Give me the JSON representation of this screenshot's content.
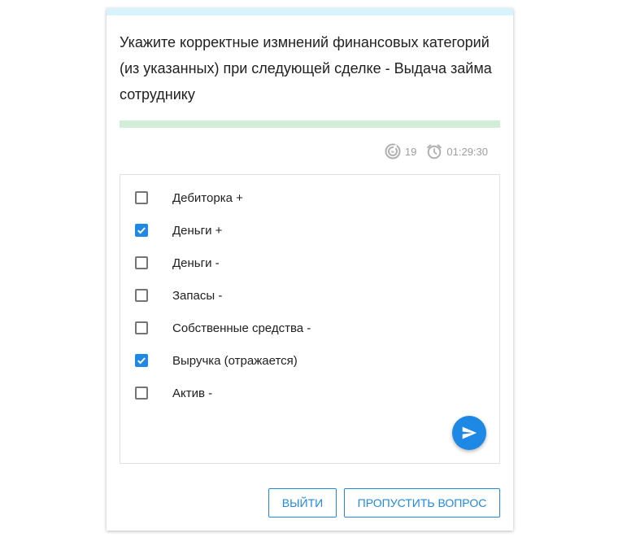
{
  "question": {
    "text": "Укажите корректные измнений финансовых категорий (из указанных) при следующей сделке - Выдача займа сотруднику"
  },
  "progress": {
    "fraction": 1.0
  },
  "stats": {
    "score_icon": "target-icon",
    "score_value": "19",
    "timer_icon": "alarm-clock-icon",
    "timer_value": "01:29:30"
  },
  "options": [
    {
      "label": "Дебиторка +",
      "checked": false
    },
    {
      "label": "Деньги +",
      "checked": true
    },
    {
      "label": "Деньги -",
      "checked": false
    },
    {
      "label": "Запасы -",
      "checked": false
    },
    {
      "label": "Собственные средства -",
      "checked": false
    },
    {
      "label": "Выручка (отражается)",
      "checked": true
    },
    {
      "label": "Актив -",
      "checked": false
    }
  ],
  "send_button": {
    "icon": "send-icon"
  },
  "buttons": {
    "exit_label": "ВЫЙТИ",
    "skip_label": "ПРОПУСТИТЬ ВОПРОС"
  },
  "colors": {
    "accent": "#1e88e5",
    "top_strip": "#d8f3fb",
    "progress": "#d2eed8",
    "muted_text": "#9e9e9e"
  }
}
